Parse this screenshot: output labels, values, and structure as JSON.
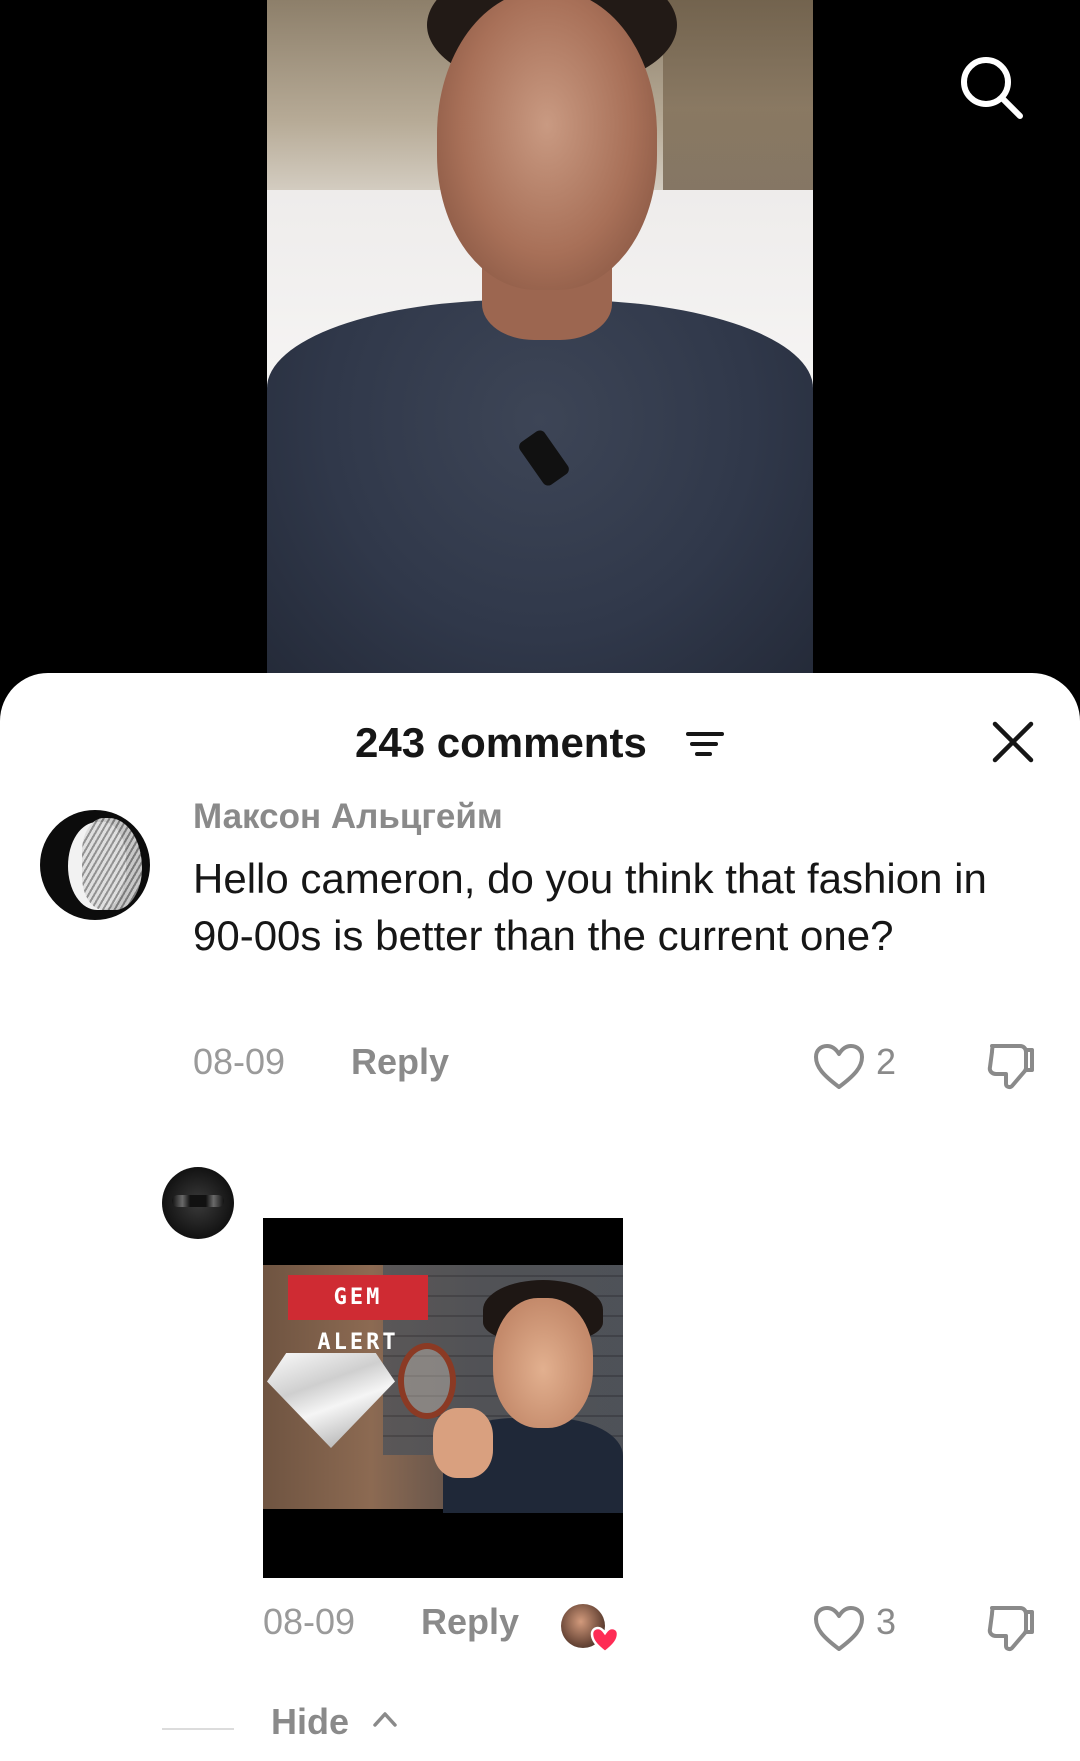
{
  "header": {
    "comments_count": "243 comments"
  },
  "icons": {
    "search": "search-icon",
    "sort": "sort-icon",
    "close": "close-icon",
    "like": "heart-outline-icon",
    "dislike": "thumbs-down-icon",
    "creator_liked": "heart-filled-icon",
    "chevron": "chevron-up-icon"
  },
  "colors": {
    "text_primary": "#161616",
    "text_secondary": "#8a8a8a",
    "creator_heart": "#fe2c55",
    "gem_tag": "#cf2b33"
  },
  "comments": [
    {
      "username": "Максон Альцгейм",
      "text": "Hello cameron, do you think that fashion in 90-00s is better than the current one?",
      "date": "08-09",
      "reply_label": "Reply",
      "likes": "2"
    },
    {
      "thumbnail_badge": "GEM ALERT",
      "date": "08-09",
      "reply_label": "Reply",
      "likes": "3",
      "liked_by_creator": true
    }
  ],
  "hide": {
    "label": "Hide"
  }
}
